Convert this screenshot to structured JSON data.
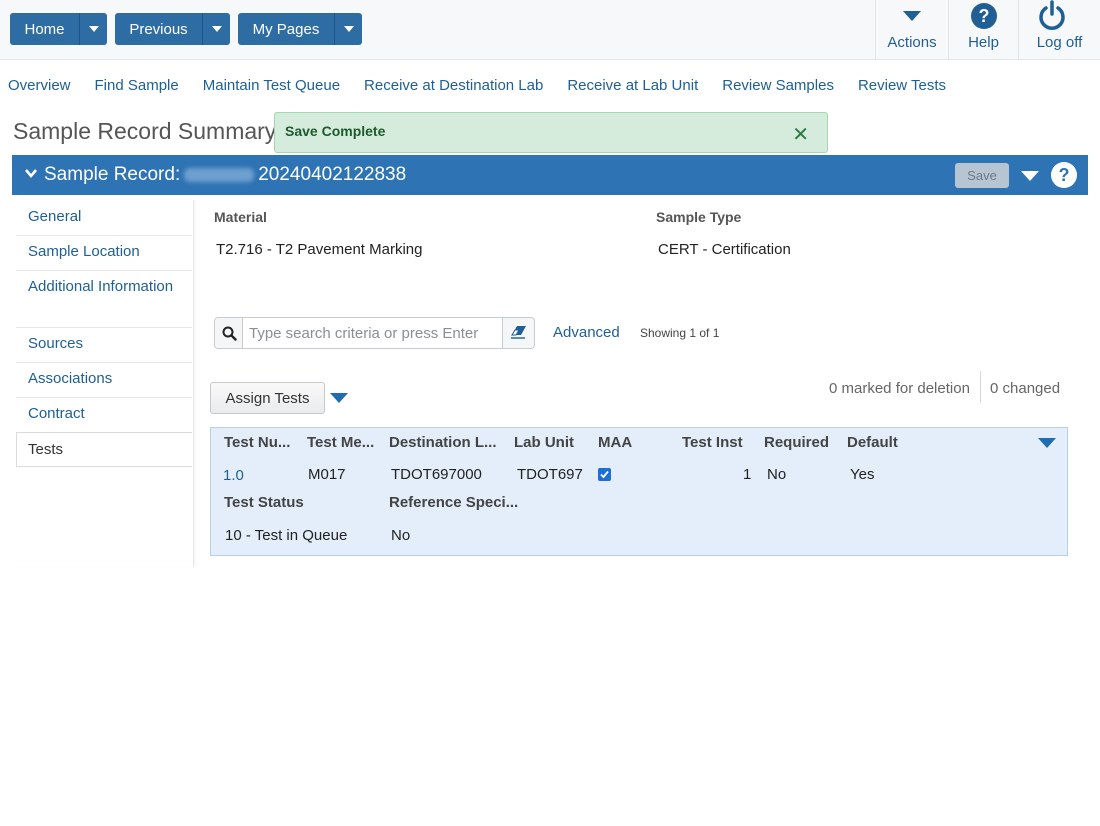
{
  "topbar": {
    "home_label": "Home",
    "previous_label": "Previous",
    "mypages_label": "My Pages",
    "actions_label": "Actions",
    "help_label": "Help",
    "logoff_label": "Log off"
  },
  "nav": {
    "links": [
      "Overview",
      "Find Sample",
      "Maintain Test Queue",
      "Receive at Destination Lab",
      "Receive at Lab Unit",
      "Review Samples",
      "Review Tests"
    ]
  },
  "page": {
    "title": "Sample Record Summary"
  },
  "toast": {
    "message": "Save Complete",
    "close_glyph": "✕"
  },
  "record": {
    "title_prefix": "Sample Record:",
    "id_suffix": "20240402122838",
    "save_label": "Save"
  },
  "sidebar": {
    "items": [
      {
        "label": "General"
      },
      {
        "label": "Sample Location"
      },
      {
        "label": "Additional Information"
      },
      {
        "label": "Sources"
      },
      {
        "label": "Associations"
      },
      {
        "label": "Contract"
      },
      {
        "label": "Tests"
      }
    ],
    "active": "Tests"
  },
  "fields": {
    "material_label": "Material",
    "material_value": "T2.716 - T2 Pavement Marking",
    "sampletype_label": "Sample Type",
    "sampletype_value": "CERT - Certification"
  },
  "search": {
    "placeholder": "Type search criteria or press Enter",
    "advanced_label": "Advanced",
    "showing_text": "Showing 1 of 1"
  },
  "tests_toolbar": {
    "assign_label": "Assign Tests",
    "marked_text": "0 marked for deletion",
    "changed_text": "0 changed"
  },
  "grid": {
    "headers": [
      "Test Nu...",
      "Test Me...",
      "Destination L...",
      "Lab Unit",
      "MAA",
      "Test Inst",
      "Required",
      "Default"
    ],
    "row": {
      "test_number": "1.0",
      "test_method": "M017",
      "destination_lab": "TDOT697000",
      "lab_unit": "TDOT697",
      "maa_checked": true,
      "test_inst": "1",
      "required": "No",
      "default": "Yes"
    },
    "sub_headers": [
      "Test Status",
      "Reference Speci..."
    ],
    "sub_row": {
      "test_status": "10 - Test in Queue",
      "reference_spec": "No"
    }
  },
  "colors": {
    "primary": "#2e6da4",
    "header_bar": "#2e73b3",
    "link": "#1f5f94",
    "toast_bg": "#d5ebdb",
    "grid_bg": "#e3eefa"
  }
}
